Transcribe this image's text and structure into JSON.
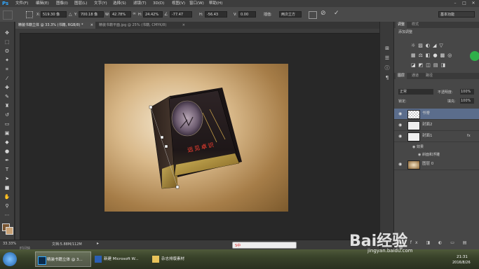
{
  "app": {
    "logo": "Ps",
    "brand_color": "#31a8ff"
  },
  "menu": [
    "文件(F)",
    "编辑(E)",
    "图像(I)",
    "图层(L)",
    "文字(Y)",
    "选择(S)",
    "滤镜(T)",
    "3D(D)",
    "视图(V)",
    "窗口(W)",
    "帮助(H)"
  ],
  "window_controls": {
    "minimize": "–",
    "maximize": "□",
    "close": "✕"
  },
  "options": {
    "x_label": "X:",
    "x_value": "519.30 像",
    "y_label": "Y:",
    "y_value": "700.18 像",
    "w_label": "W:",
    "w_value": "42.78%",
    "h_label": "H:",
    "h_value": "24.42%",
    "rot_value": "-77.47",
    "h2_label": "H:",
    "h2_value": "-56.43",
    "v_label": "V:",
    "v_value": "0.00",
    "interp_label": "插值:",
    "interp_value": "两次立方",
    "workspace": "基本功能"
  },
  "tabs": [
    {
      "label": "精装书籍立体 @ 33.3% (书籍, RGB/8) *",
      "close": "×"
    },
    {
      "label": "精装书籍平面.jpg @ 25% (书籍, CMYK/8)",
      "close": "×"
    }
  ],
  "cover_title": "远见卓识",
  "status": {
    "zoom": "33.33%",
    "doc": "文档:5.88M/112M",
    "timeline": "时间轴"
  },
  "panels": {
    "tab_adjust": "调整",
    "tab_styles": "样式",
    "add_adjust": "添加调整",
    "tab_layers": "图层",
    "tab_channels": "通道",
    "tab_paths": "路径",
    "blend_mode": "正常",
    "opacity_label": "不透明度:",
    "opacity_value": "100%",
    "lock_label": "锁定:",
    "fill_label": "填充:",
    "fill_value": "100%",
    "layers": [
      {
        "name": "书脊",
        "selected": true
      },
      {
        "name": "封面2",
        "selected": false
      },
      {
        "name": "封面1",
        "selected": false,
        "fx": "fx"
      },
      {
        "name": "效果",
        "sub": true
      },
      {
        "name": "斜面和浮雕",
        "sub2": true
      },
      {
        "name": "图层 0",
        "selected": false
      }
    ]
  },
  "ime": "S中",
  "taskbar": {
    "items": [
      "精装书籍立体 @ 3...",
      "新建 Microsoft W...",
      "杂志排版素材"
    ],
    "time": "21:31",
    "date": "2016/8/26"
  },
  "watermark": {
    "text": "Bai经验",
    "url": "jingyan.baidu.com"
  }
}
